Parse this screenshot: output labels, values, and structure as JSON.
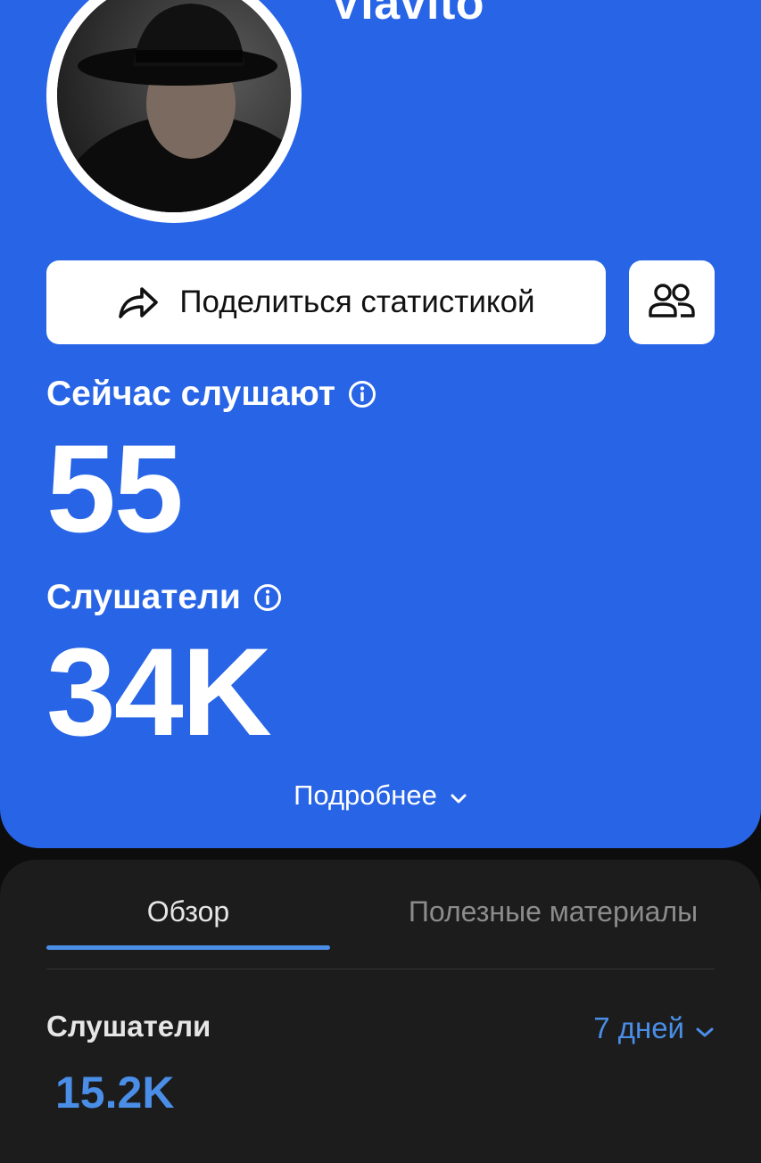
{
  "artist": {
    "name": "Viavito"
  },
  "actions": {
    "share_label": "Поделиться статистикой"
  },
  "stats": {
    "now_listening": {
      "label": "Сейчас слушают",
      "value": "55"
    },
    "listeners": {
      "label": "Слушатели",
      "value": "34K"
    }
  },
  "more": {
    "label": "Подробнее"
  },
  "tabs": [
    {
      "label": "Обзор",
      "active": true
    },
    {
      "label": "Полезные материалы",
      "active": false
    }
  ],
  "overview": {
    "title": "Слушатели",
    "period": "7 дней",
    "value": "15.2K"
  },
  "colors": {
    "hero_blue": "#2864e6",
    "accent_blue": "#4a8ee8",
    "panel_dark": "#1c1c1c"
  },
  "icons": [
    "share-icon",
    "people-icon",
    "info-icon",
    "chevron-down-icon"
  ]
}
